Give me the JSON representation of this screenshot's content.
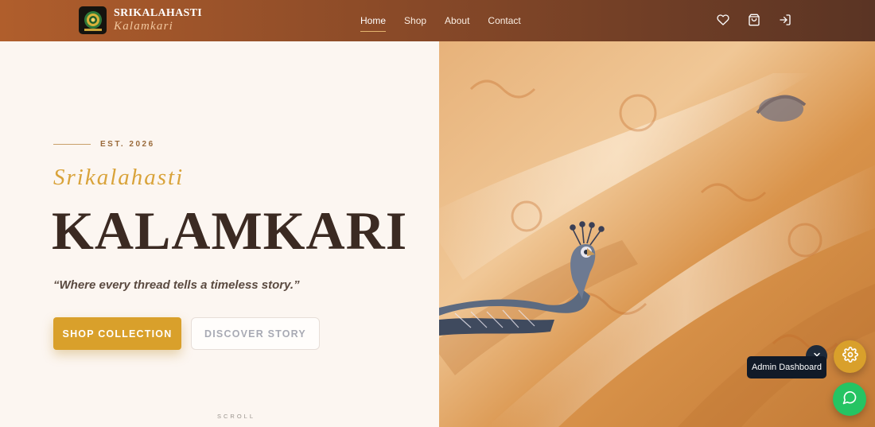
{
  "brand": {
    "title": "SRIKALAHASTI",
    "subtitle": "Kalamkari"
  },
  "nav": {
    "links": [
      {
        "label": "Home",
        "active": true
      },
      {
        "label": "Shop",
        "active": false
      },
      {
        "label": "About",
        "active": false
      },
      {
        "label": "Contact",
        "active": false
      }
    ],
    "icons": [
      "heart-icon",
      "shopping-bag-icon",
      "login-icon"
    ]
  },
  "hero": {
    "est": "EST. 2026",
    "subtitle": "Srikalahasti",
    "title": "KALAMKARI",
    "quote": "“Where every thread tells a timeless story.”",
    "primary_button": "SHOP COLLECTION",
    "secondary_button": "DISCOVER STORY",
    "scroll": "SCROLL"
  },
  "floating": {
    "tooltip": "Admin Dashboard",
    "settings_icon": "gear-icon",
    "collapse_icon": "chevron-down-icon",
    "chat_icon": "whatsapp-chat-icon"
  },
  "colors": {
    "nav_start": "#b05e2c",
    "nav_end": "#5a3424",
    "accent_gold": "#d9a02b",
    "title_dark": "#3b2a22",
    "hero_bg": "#fcf6f1",
    "chat_green": "#25c463"
  }
}
